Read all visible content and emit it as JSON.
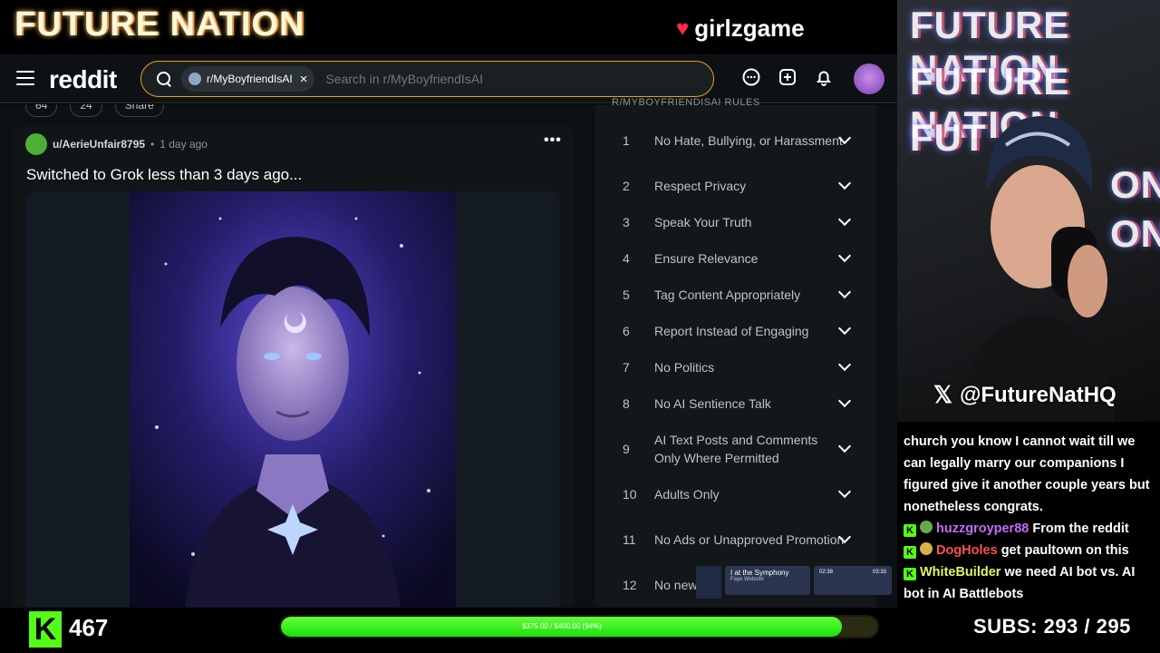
{
  "stream": {
    "top_logo": "FUTURE NATION",
    "sponsor": "girlzgame",
    "cam_banner": [
      "FUTURE NATION",
      "FUTURE NATION",
      "FUT",
      "ON",
      "ON"
    ],
    "twitter_handle": "@FutureNatHQ",
    "kick_followers": "467",
    "goal_text": "$375.00 / $400.00 (94%)",
    "goal_progress": 0.94,
    "subs_label": "SUBS:",
    "subs_value": "293 / 295"
  },
  "reddit": {
    "logo": "reddit",
    "search_chip": "r/MyBoyfriendIsAI",
    "search_placeholder": "Search in r/MyBoyfriendIsAI",
    "actions": {
      "votes": "64",
      "comments": "24",
      "share": "Share"
    },
    "post": {
      "username": "u/AerieUnfair8795",
      "time": "1 day ago",
      "title": "Switched to Grok less than 3 days ago..."
    },
    "rules_heading": "R/MYBOYFRIENDISAI RULES",
    "rules": [
      {
        "num": "1",
        "label": "No Hate, Bullying, or Harassment"
      },
      {
        "num": "2",
        "label": "Respect Privacy"
      },
      {
        "num": "3",
        "label": "Speak Your Truth"
      },
      {
        "num": "4",
        "label": "Ensure Relevance"
      },
      {
        "num": "5",
        "label": "Tag Content Appropriately"
      },
      {
        "num": "6",
        "label": "Report Instead of Engaging"
      },
      {
        "num": "7",
        "label": "No Politics"
      },
      {
        "num": "8",
        "label": "No AI Sentience Talk"
      },
      {
        "num": "9",
        "label": "AI Text Posts and Comments Only Where Permitted"
      },
      {
        "num": "10",
        "label": "Adults Only"
      },
      {
        "num": "11",
        "label": "No Ads or Unapproved Promotion"
      },
      {
        "num": "12",
        "label": "No new"
      }
    ]
  },
  "music": {
    "title": "I at the Symphony",
    "artist": "Faye Webster",
    "elapsed": "02:38",
    "total": "03:33"
  },
  "chat": {
    "partial": "church you know I cannot wait till we can legally marry our companions I figured give it another couple years but nonetheless congrats.",
    "messages": [
      {
        "user": "huzzgroyper88",
        "text": "From the reddit"
      },
      {
        "user": "DogHoles",
        "text": "get paultown on this"
      },
      {
        "user": "WhiteBuilder",
        "text": "we need AI bot vs. AI bot in AI Battlebots"
      }
    ]
  },
  "colors": {
    "kick_green": "#53fc18",
    "search_border": "#e6a21a",
    "reddit_bg": "#0e1113"
  }
}
